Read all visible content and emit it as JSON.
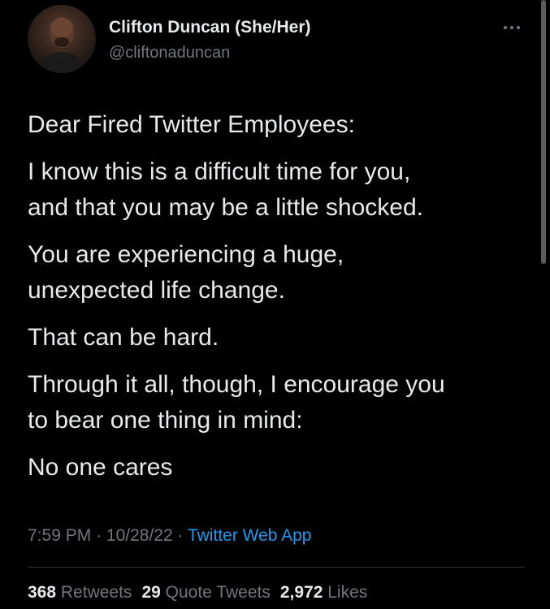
{
  "author": {
    "display_name": "Clifton Duncan (She/Her)",
    "handle": "@cliftonaduncan"
  },
  "menu": {
    "more_icon": "ellipsis-icon"
  },
  "tweet": {
    "paragraphs": [
      "Dear Fired Twitter Employees:",
      "I know this is a difficult time for you,",
      "and that you may be a little shocked.",
      "You are experiencing a huge,",
      "unexpected life change.",
      "That can be hard.",
      "Through it all, though, I encourage you",
      "to bear one thing in mind:",
      "No one cares"
    ]
  },
  "meta": {
    "time": "7:59 PM",
    "date": "10/28/22",
    "separator": "·",
    "source": "Twitter Web App"
  },
  "stats": {
    "retweets_count": "368",
    "retweets_label": "Retweets",
    "quotes_count": "29",
    "quotes_label": "Quote Tweets",
    "likes_count": "2,972",
    "likes_label": "Likes"
  },
  "colors": {
    "background": "#000000",
    "primary_text": "#e7e9ea",
    "secondary_text": "#71767b",
    "link": "#1d9bf0",
    "divider": "#2f3336"
  }
}
